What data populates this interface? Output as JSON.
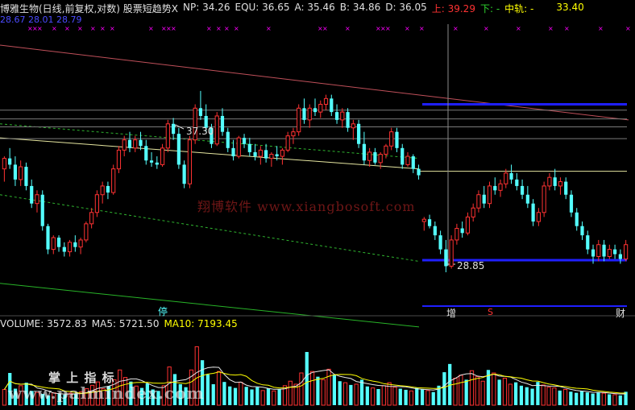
{
  "header": {
    "title": "博雅生物(日线,前复权,对数) 股票短趋势X",
    "np_label": "NP:",
    "np": "34.26",
    "equ_label": "EQU:",
    "equ": "36.65",
    "a_label": "A:",
    "a": "35.46",
    "b_label": "B:",
    "b": "34.86",
    "d_label": "D:",
    "d": "36.05",
    "up_label": "上:",
    "up": "39.29",
    "down_label": "下:",
    "down": "-",
    "mid_label": "中轨:",
    "mid": "-",
    "extra": "33.40",
    "second_line": "28.67  28.01  28.79"
  },
  "volume_header": {
    "volume_label": "VOLUME:",
    "volume": "3572.83",
    "ma5_label": "MA5:",
    "ma5": "5721.50",
    "ma10_label": "MA10:",
    "ma10": "7193.45"
  },
  "annotations": {
    "high": "37.30",
    "low": "28.85",
    "tag_ting": "停",
    "tag_zeng": "增",
    "tag_s": "S",
    "tag_cai": "财"
  },
  "watermark": {
    "center": "翔博软件 www.xiangbosoft.com",
    "bottom_cn": "掌 上 指 标",
    "bottom_url": "www.palmindex.com"
  },
  "colors": {
    "up": "#ff3232",
    "down": "#54ffff",
    "yellow": "#ffff00",
    "blue": "#1f1fff",
    "magenta": "#ff00ff"
  },
  "chart_data": [
    {
      "type": "candlestick",
      "title": "博雅生物(日线,前复权,对数)",
      "scale": "log",
      "ylim": [
        27.5,
        41
      ],
      "candles": [
        {
          "o": 33.4,
          "h": 34.0,
          "l": 32.8,
          "c": 33.9
        },
        {
          "o": 33.9,
          "h": 34.4,
          "l": 33.4,
          "c": 33.6
        },
        {
          "o": 33.6,
          "h": 34.0,
          "l": 32.6,
          "c": 32.9
        },
        {
          "o": 32.9,
          "h": 33.8,
          "l": 32.6,
          "c": 33.5
        },
        {
          "o": 33.5,
          "h": 33.7,
          "l": 32.4,
          "c": 32.6
        },
        {
          "o": 32.6,
          "h": 32.9,
          "l": 31.6,
          "c": 31.8
        },
        {
          "o": 31.8,
          "h": 32.4,
          "l": 31.4,
          "c": 32.2
        },
        {
          "o": 32.2,
          "h": 32.4,
          "l": 30.6,
          "c": 30.8
        },
        {
          "o": 30.8,
          "h": 30.9,
          "l": 29.6,
          "c": 29.8
        },
        {
          "o": 29.8,
          "h": 30.4,
          "l": 29.6,
          "c": 30.3
        },
        {
          "o": 30.3,
          "h": 30.4,
          "l": 29.7,
          "c": 29.9
        },
        {
          "o": 29.9,
          "h": 30.1,
          "l": 29.5,
          "c": 29.7
        },
        {
          "o": 29.7,
          "h": 30.2,
          "l": 29.5,
          "c": 30.1
        },
        {
          "o": 30.1,
          "h": 30.4,
          "l": 29.7,
          "c": 29.9
        },
        {
          "o": 29.9,
          "h": 30.3,
          "l": 29.6,
          "c": 30.2
        },
        {
          "o": 30.2,
          "h": 31.0,
          "l": 30.1,
          "c": 30.9
        },
        {
          "o": 30.9,
          "h": 31.6,
          "l": 30.7,
          "c": 31.4
        },
        {
          "o": 31.4,
          "h": 32.4,
          "l": 31.2,
          "c": 32.2
        },
        {
          "o": 32.2,
          "h": 32.8,
          "l": 31.8,
          "c": 32.6
        },
        {
          "o": 32.6,
          "h": 32.8,
          "l": 32.0,
          "c": 32.3
        },
        {
          "o": 32.3,
          "h": 33.6,
          "l": 32.2,
          "c": 33.4
        },
        {
          "o": 33.4,
          "h": 34.5,
          "l": 33.2,
          "c": 34.3
        },
        {
          "o": 34.3,
          "h": 35.0,
          "l": 34.0,
          "c": 34.8
        },
        {
          "o": 34.8,
          "h": 35.2,
          "l": 34.2,
          "c": 34.4
        },
        {
          "o": 34.4,
          "h": 35.0,
          "l": 34.2,
          "c": 34.8
        },
        {
          "o": 34.8,
          "h": 35.2,
          "l": 34.3,
          "c": 34.5
        },
        {
          "o": 34.5,
          "h": 34.8,
          "l": 33.6,
          "c": 33.8
        },
        {
          "o": 33.8,
          "h": 34.2,
          "l": 33.5,
          "c": 33.7
        },
        {
          "o": 33.7,
          "h": 34.0,
          "l": 33.4,
          "c": 33.6
        },
        {
          "o": 33.6,
          "h": 34.6,
          "l": 33.5,
          "c": 34.4
        },
        {
          "o": 34.4,
          "h": 35.8,
          "l": 34.2,
          "c": 35.6
        },
        {
          "o": 35.6,
          "h": 35.9,
          "l": 34.8,
          "c": 35.1
        },
        {
          "o": 35.1,
          "h": 35.4,
          "l": 33.4,
          "c": 33.6
        },
        {
          "o": 33.6,
          "h": 33.8,
          "l": 32.5,
          "c": 32.7
        },
        {
          "o": 32.7,
          "h": 35.0,
          "l": 32.5,
          "c": 34.8
        },
        {
          "o": 34.8,
          "h": 36.6,
          "l": 34.6,
          "c": 36.4
        },
        {
          "o": 36.4,
          "h": 37.3,
          "l": 35.8,
          "c": 36.0
        },
        {
          "o": 36.0,
          "h": 36.6,
          "l": 35.2,
          "c": 35.4
        },
        {
          "o": 35.4,
          "h": 35.6,
          "l": 34.4,
          "c": 34.6
        },
        {
          "o": 34.6,
          "h": 36.2,
          "l": 34.5,
          "c": 36.0
        },
        {
          "o": 36.0,
          "h": 36.4,
          "l": 35.0,
          "c": 35.2
        },
        {
          "o": 35.2,
          "h": 35.4,
          "l": 34.2,
          "c": 34.4
        },
        {
          "o": 34.4,
          "h": 34.8,
          "l": 33.8,
          "c": 34.0
        },
        {
          "o": 34.0,
          "h": 35.0,
          "l": 33.9,
          "c": 34.9
        },
        {
          "o": 34.9,
          "h": 35.1,
          "l": 34.4,
          "c": 34.6
        },
        {
          "o": 34.6,
          "h": 34.9,
          "l": 34.0,
          "c": 34.2
        },
        {
          "o": 34.2,
          "h": 34.6,
          "l": 33.8,
          "c": 34.0
        },
        {
          "o": 34.0,
          "h": 34.5,
          "l": 33.6,
          "c": 34.3
        },
        {
          "o": 34.3,
          "h": 34.6,
          "l": 33.7,
          "c": 33.9
        },
        {
          "o": 33.9,
          "h": 34.2,
          "l": 33.5,
          "c": 34.1
        },
        {
          "o": 34.1,
          "h": 34.5,
          "l": 33.8,
          "c": 34.0
        },
        {
          "o": 34.0,
          "h": 34.4,
          "l": 33.6,
          "c": 34.3
        },
        {
          "o": 34.3,
          "h": 35.2,
          "l": 34.2,
          "c": 35.0
        },
        {
          "o": 35.0,
          "h": 35.4,
          "l": 34.6,
          "c": 35.2
        },
        {
          "o": 35.2,
          "h": 36.6,
          "l": 35.0,
          "c": 36.4
        },
        {
          "o": 36.4,
          "h": 36.9,
          "l": 35.6,
          "c": 35.8
        },
        {
          "o": 35.8,
          "h": 36.6,
          "l": 35.4,
          "c": 36.4
        },
        {
          "o": 36.4,
          "h": 36.9,
          "l": 36.0,
          "c": 36.2
        },
        {
          "o": 36.2,
          "h": 36.8,
          "l": 35.9,
          "c": 36.6
        },
        {
          "o": 36.6,
          "h": 37.1,
          "l": 36.3,
          "c": 36.9
        },
        {
          "o": 36.9,
          "h": 37.1,
          "l": 36.0,
          "c": 36.2
        },
        {
          "o": 36.2,
          "h": 36.6,
          "l": 35.6,
          "c": 35.8
        },
        {
          "o": 35.8,
          "h": 36.4,
          "l": 35.4,
          "c": 36.2
        },
        {
          "o": 36.2,
          "h": 36.4,
          "l": 35.2,
          "c": 35.4
        },
        {
          "o": 35.4,
          "h": 35.8,
          "l": 34.8,
          "c": 35.6
        },
        {
          "o": 35.6,
          "h": 35.8,
          "l": 34.4,
          "c": 34.6
        },
        {
          "o": 34.6,
          "h": 35.2,
          "l": 33.6,
          "c": 33.8
        },
        {
          "o": 33.8,
          "h": 34.4,
          "l": 33.5,
          "c": 34.2
        },
        {
          "o": 34.2,
          "h": 34.4,
          "l": 33.6,
          "c": 33.7
        },
        {
          "o": 33.7,
          "h": 34.2,
          "l": 33.4,
          "c": 34.1
        },
        {
          "o": 34.1,
          "h": 34.6,
          "l": 33.9,
          "c": 34.5
        },
        {
          "o": 34.5,
          "h": 35.4,
          "l": 34.3,
          "c": 35.2
        },
        {
          "o": 35.2,
          "h": 35.4,
          "l": 34.2,
          "c": 34.4
        },
        {
          "o": 34.4,
          "h": 34.6,
          "l": 33.4,
          "c": 33.6
        },
        {
          "o": 33.6,
          "h": 34.2,
          "l": 33.5,
          "c": 34.0
        },
        {
          "o": 34.0,
          "h": 34.1,
          "l": 33.2,
          "c": 33.4
        },
        {
          "o": 33.4,
          "h": 33.6,
          "l": 32.9,
          "c": 33.1
        },
        {
          "o": 31.0,
          "h": 31.2,
          "l": 30.6,
          "c": 31.1
        },
        {
          "o": 31.1,
          "h": 31.3,
          "l": 30.7,
          "c": 30.8
        },
        {
          "o": 30.8,
          "h": 31.0,
          "l": 30.2,
          "c": 30.4
        },
        {
          "o": 30.4,
          "h": 30.6,
          "l": 29.6,
          "c": 29.8
        },
        {
          "o": 29.8,
          "h": 30.2,
          "l": 28.85,
          "c": 29.1
        },
        {
          "o": 29.1,
          "h": 30.4,
          "l": 29.0,
          "c": 30.2
        },
        {
          "o": 30.2,
          "h": 30.9,
          "l": 30.0,
          "c": 30.7
        },
        {
          "o": 30.7,
          "h": 31.0,
          "l": 30.3,
          "c": 30.5
        },
        {
          "o": 30.5,
          "h": 31.4,
          "l": 30.4,
          "c": 31.2
        },
        {
          "o": 31.2,
          "h": 31.8,
          "l": 31.0,
          "c": 31.6
        },
        {
          "o": 31.6,
          "h": 32.4,
          "l": 31.4,
          "c": 32.2
        },
        {
          "o": 32.2,
          "h": 32.6,
          "l": 31.6,
          "c": 31.8
        },
        {
          "o": 31.8,
          "h": 32.8,
          "l": 31.6,
          "c": 32.6
        },
        {
          "o": 32.6,
          "h": 33.0,
          "l": 32.2,
          "c": 32.4
        },
        {
          "o": 32.4,
          "h": 32.9,
          "l": 32.1,
          "c": 32.7
        },
        {
          "o": 32.7,
          "h": 33.4,
          "l": 32.5,
          "c": 33.2
        },
        {
          "o": 33.2,
          "h": 33.6,
          "l": 32.7,
          "c": 32.9
        },
        {
          "o": 32.9,
          "h": 33.2,
          "l": 32.4,
          "c": 32.6
        },
        {
          "o": 32.6,
          "h": 32.9,
          "l": 32.0,
          "c": 32.2
        },
        {
          "o": 32.2,
          "h": 32.6,
          "l": 31.6,
          "c": 31.8
        },
        {
          "o": 31.8,
          "h": 32.0,
          "l": 30.8,
          "c": 31.0
        },
        {
          "o": 31.0,
          "h": 31.6,
          "l": 30.8,
          "c": 31.4
        },
        {
          "o": 31.4,
          "h": 32.8,
          "l": 31.2,
          "c": 32.6
        },
        {
          "o": 32.6,
          "h": 33.2,
          "l": 32.4,
          "c": 33.0
        },
        {
          "o": 33.0,
          "h": 33.4,
          "l": 32.4,
          "c": 32.6
        },
        {
          "o": 32.6,
          "h": 33.0,
          "l": 32.2,
          "c": 32.8
        },
        {
          "o": 32.8,
          "h": 33.0,
          "l": 32.0,
          "c": 32.2
        },
        {
          "o": 32.2,
          "h": 32.4,
          "l": 31.2,
          "c": 31.4
        },
        {
          "o": 31.4,
          "h": 31.6,
          "l": 30.6,
          "c": 30.8
        },
        {
          "o": 30.8,
          "h": 31.0,
          "l": 30.2,
          "c": 30.4
        },
        {
          "o": 30.4,
          "h": 30.6,
          "l": 29.6,
          "c": 29.8
        },
        {
          "o": 29.8,
          "h": 30.0,
          "l": 29.2,
          "c": 29.5
        },
        {
          "o": 29.5,
          "h": 30.2,
          "l": 29.3,
          "c": 30.0
        },
        {
          "o": 30.0,
          "h": 30.2,
          "l": 29.3,
          "c": 29.5
        },
        {
          "o": 29.5,
          "h": 30.0,
          "l": 29.4,
          "c": 29.8
        },
        {
          "o": 29.8,
          "h": 30.0,
          "l": 29.4,
          "c": 29.6
        },
        {
          "o": 29.6,
          "h": 29.8,
          "l": 29.2,
          "c": 29.4
        },
        {
          "o": 29.4,
          "h": 30.2,
          "l": 29.3,
          "c": 30.0
        }
      ],
      "bands": {
        "upper_red": [
          39.8,
          35.8
        ],
        "green_dash_upper": [
          35.6,
          33.9
        ],
        "yellow_line": [
          34.9,
          33.4
        ],
        "green_dash_lower": [
          32.2,
          29.3
        ],
        "green_solid_low": [
          28.4,
          26.7
        ],
        "gray_levels": [
          36.3,
          35.85,
          35.45,
          34.86
        ],
        "blue_upper": 36.6,
        "blue_lower": 29.35
      }
    },
    {
      "type": "bar",
      "title": "VOLUME",
      "ylim": [
        0,
        20000
      ],
      "series": [
        {
          "name": "VOLUME",
          "values": [
            4200,
            8600,
            4400,
            5200,
            6000,
            3800,
            3400,
            3000,
            2600,
            3300,
            3000,
            2800,
            3200,
            2900,
            3600,
            4400,
            5300,
            6200,
            4400,
            5100,
            6800,
            9400,
            7400,
            6300,
            5100,
            4600,
            5800,
            4200,
            3800,
            5200,
            10200,
            8300,
            5600,
            4800,
            9400,
            15600,
            12000,
            8200,
            5600,
            9000,
            6200,
            5000,
            4600,
            6100,
            4900,
            4200,
            4800,
            3900,
            4500,
            3800,
            4300,
            5200,
            6400,
            5600,
            8600,
            14200,
            9000,
            7600,
            6800,
            9600,
            8200,
            6400,
            6000,
            5400,
            5600,
            6800,
            5000,
            4600,
            4300,
            5200,
            6000,
            4800,
            4400,
            4100,
            3800,
            4600,
            4300,
            3900,
            3500,
            5200,
            8800,
            11000,
            7200,
            8000,
            6800,
            9200,
            7600,
            6400,
            9400,
            8600,
            6800,
            7200,
            5600,
            6100,
            5200,
            4800,
            4400,
            6200,
            5400,
            4800,
            4600,
            3900,
            4200,
            3600,
            3300,
            3800,
            3400,
            3100,
            3500,
            3200,
            2900,
            2800,
            2600,
            3572.83
          ]
        },
        {
          "name": "MA5",
          "values": []
        },
        {
          "name": "MA10",
          "values": []
        }
      ]
    }
  ]
}
